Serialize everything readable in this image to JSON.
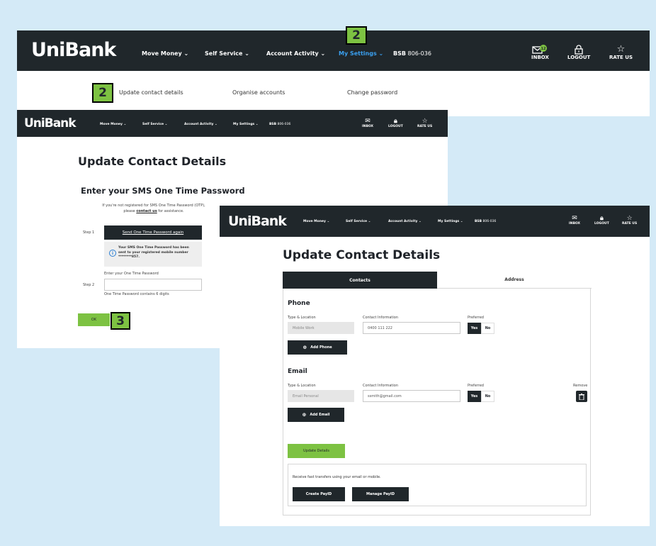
{
  "brand": "UniBank",
  "nav": {
    "items": [
      "Move Money ⌄",
      "Self Service ⌄",
      "Account Activity ⌄",
      "My Settings ⌄"
    ],
    "bsb_label": "BSB",
    "bsb_value": "806-036",
    "inbox_label": "INBOX",
    "inbox_count": "12",
    "logout_label": "LOGOUT",
    "rate_label": "RATE US"
  },
  "steps": {
    "step2_a": "2",
    "step2_b": "2",
    "step3": "3"
  },
  "submenu": [
    "Update contact details",
    "Organise accounts",
    "Change password"
  ],
  "otp": {
    "page_title": "Update Contact Details",
    "heading": "Enter your SMS One Time Password",
    "info_line1": "If you're not registered for SMS One Time Password (OTP),",
    "info_line2_pre": "please",
    "info_link": "contact us",
    "info_line2_post": "for assistance.",
    "step1_label": "Step 1",
    "send_button": "Send One Time Password again",
    "notice_line1": "Your SMS One Time Password has been",
    "notice_line2": "sent to your registered mobile number",
    "notice_line3": "********857.",
    "enter_label": "Enter your One Time Password",
    "step2_label": "Step 2",
    "hint": "One Time Password contains 6 digits",
    "ok_button": "OK"
  },
  "contact": {
    "page_title": "Update Contact Details",
    "tabs": [
      "Contacts",
      "Address"
    ],
    "phone_heading": "Phone",
    "email_heading": "Email",
    "col_type": "Type & Location",
    "col_info": "Contact Information",
    "col_pref": "Preferred",
    "col_remove": "Remove",
    "phone_type": "Mobile Work",
    "phone_value": "0400 111 222",
    "email_type": "Email Personal",
    "email_value": "ssmith@gmail.com",
    "yes": "Yes",
    "no": "No",
    "add_phone": "Add Phone",
    "add_email": "Add Email",
    "update_button": "Update Details",
    "payid_text": "Receive fast transfers using your email or mobile.",
    "create_payid": "Create PayID",
    "manage_payid": "Manage PayID"
  }
}
